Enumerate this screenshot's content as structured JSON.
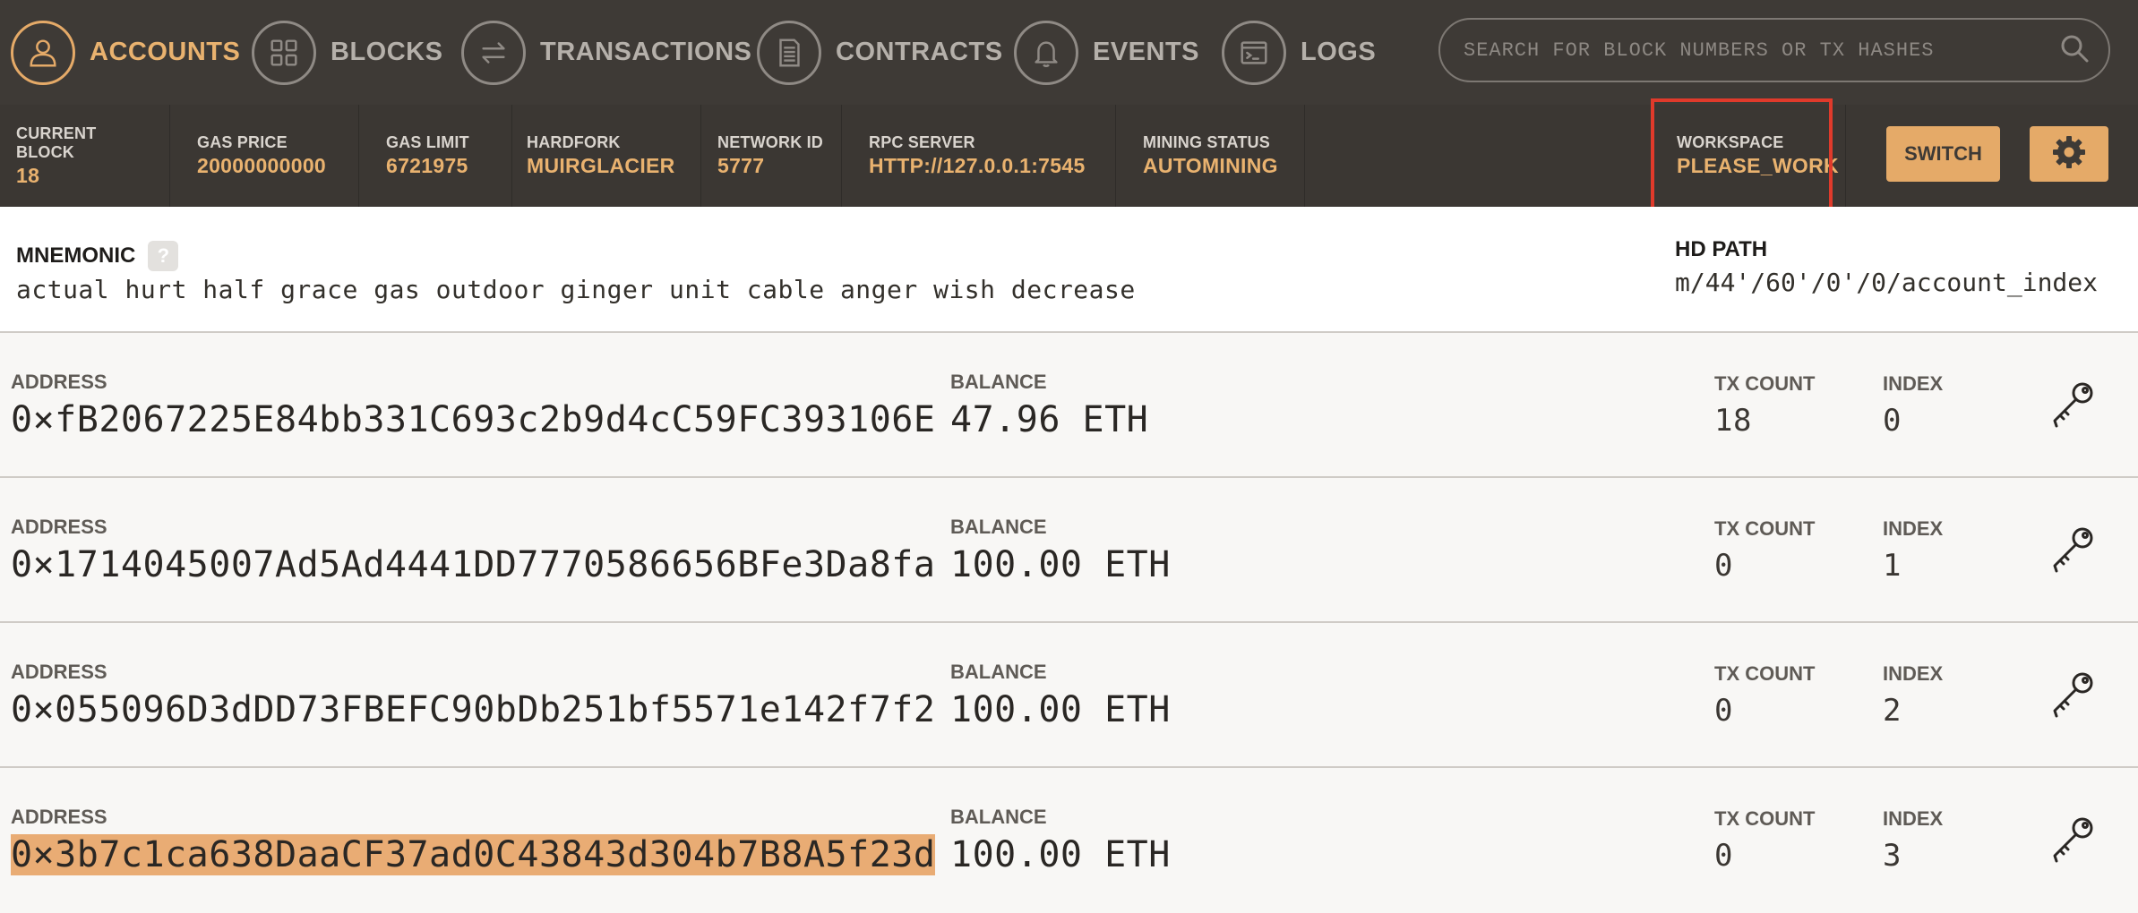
{
  "nav": {
    "items": [
      {
        "label": "ACCOUNTS",
        "icon": "person-icon",
        "active": true
      },
      {
        "label": "BLOCKS",
        "icon": "grid-icon",
        "active": false
      },
      {
        "label": "TRANSACTIONS",
        "icon": "swap-arrows-icon",
        "active": false
      },
      {
        "label": "CONTRACTS",
        "icon": "document-icon",
        "active": false
      },
      {
        "label": "EVENTS",
        "icon": "bell-icon",
        "active": false
      },
      {
        "label": "LOGS",
        "icon": "terminal-icon",
        "active": false
      }
    ],
    "search_placeholder": "SEARCH FOR BLOCK NUMBERS OR TX HASHES"
  },
  "status": {
    "current_block": {
      "label": "CURRENT BLOCK",
      "value": "18"
    },
    "gas_price": {
      "label": "GAS PRICE",
      "value": "20000000000"
    },
    "gas_limit": {
      "label": "GAS LIMIT",
      "value": "6721975"
    },
    "hardfork": {
      "label": "HARDFORK",
      "value": "MUIRGLACIER"
    },
    "network_id": {
      "label": "NETWORK ID",
      "value": "5777"
    },
    "rpc_server": {
      "label": "RPC SERVER",
      "value": "HTTP://127.0.0.1:7545"
    },
    "mining_status": {
      "label": "MINING STATUS",
      "value": "AUTOMINING"
    },
    "workspace": {
      "label": "WORKSPACE",
      "value": "PLEASE_WORK"
    },
    "switch_label": "SWITCH"
  },
  "mnemonic": {
    "title": "MNEMONIC",
    "help": "?",
    "words": "actual hurt half grace gas outdoor ginger unit cable anger wish decrease",
    "hd_path_title": "HD PATH",
    "hd_path": "m/44'/60'/0'/0/account_index"
  },
  "labels": {
    "address": "ADDRESS",
    "balance": "BALANCE",
    "tx_count": "TX COUNT",
    "index": "INDEX"
  },
  "accounts": [
    {
      "address": "0×fB2067225E84bb331C693c2b9d4cC59FC393106E",
      "balance": "47.96 ETH",
      "tx_count": "18",
      "index": "0"
    },
    {
      "address": "0×1714045007Ad5Ad4441DD7770586656BFe3Da8fa",
      "balance": "100.00 ETH",
      "tx_count": "0",
      "index": "1"
    },
    {
      "address": "0×055096D3dDD73FBEFC90bDb251bf5571e142f7f2",
      "balance": "100.00 ETH",
      "tx_count": "0",
      "index": "2"
    },
    {
      "address": "0×3b7c1ca638DaaCF37ad0C43843d304b7B8A5f23d",
      "balance": "100.00 ETH",
      "tx_count": "0",
      "index": "3"
    }
  ],
  "colors": {
    "accent": "#e9b26f",
    "nav_bg": "#3e3a36",
    "highlight_box": "#e03a2b",
    "address_selection": "#e9ac74"
  }
}
